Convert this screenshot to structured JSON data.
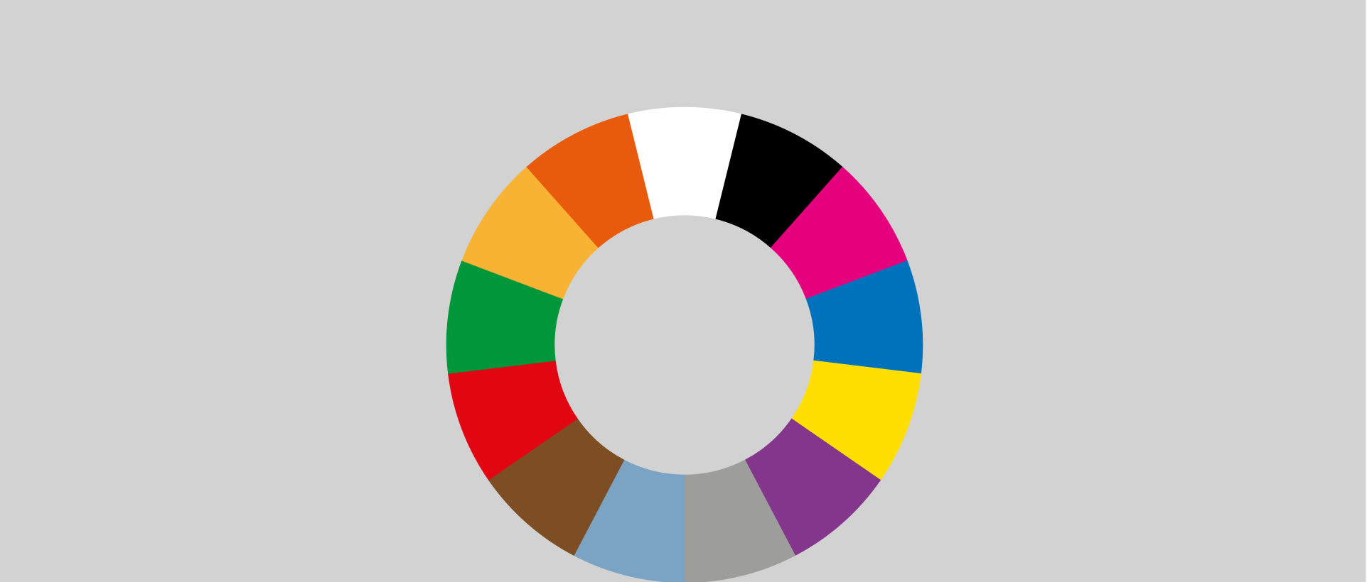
{
  "wheel": {
    "background_color": "#d2d2d2",
    "edge_color": "#f4f4f4",
    "segments": [
      {
        "name": "white-segment",
        "color": "#ffffff"
      },
      {
        "name": "black-segment",
        "color": "#000000"
      },
      {
        "name": "magenta-segment",
        "color": "#e5007d"
      },
      {
        "name": "blue-segment",
        "color": "#0072bc"
      },
      {
        "name": "yellow-segment",
        "color": "#ffde00"
      },
      {
        "name": "purple-segment",
        "color": "#83368c"
      },
      {
        "name": "grey-segment",
        "color": "#9d9d9c"
      },
      {
        "name": "light-blue-segment",
        "color": "#7ba3c4"
      },
      {
        "name": "brown-segment",
        "color": "#7d4e24"
      },
      {
        "name": "red-segment",
        "color": "#e20613"
      },
      {
        "name": "green-segment",
        "color": "#00963a"
      },
      {
        "name": "light-orange-segment",
        "color": "#f9b334"
      },
      {
        "name": "orange-segment",
        "color": "#e95b0c"
      }
    ]
  }
}
